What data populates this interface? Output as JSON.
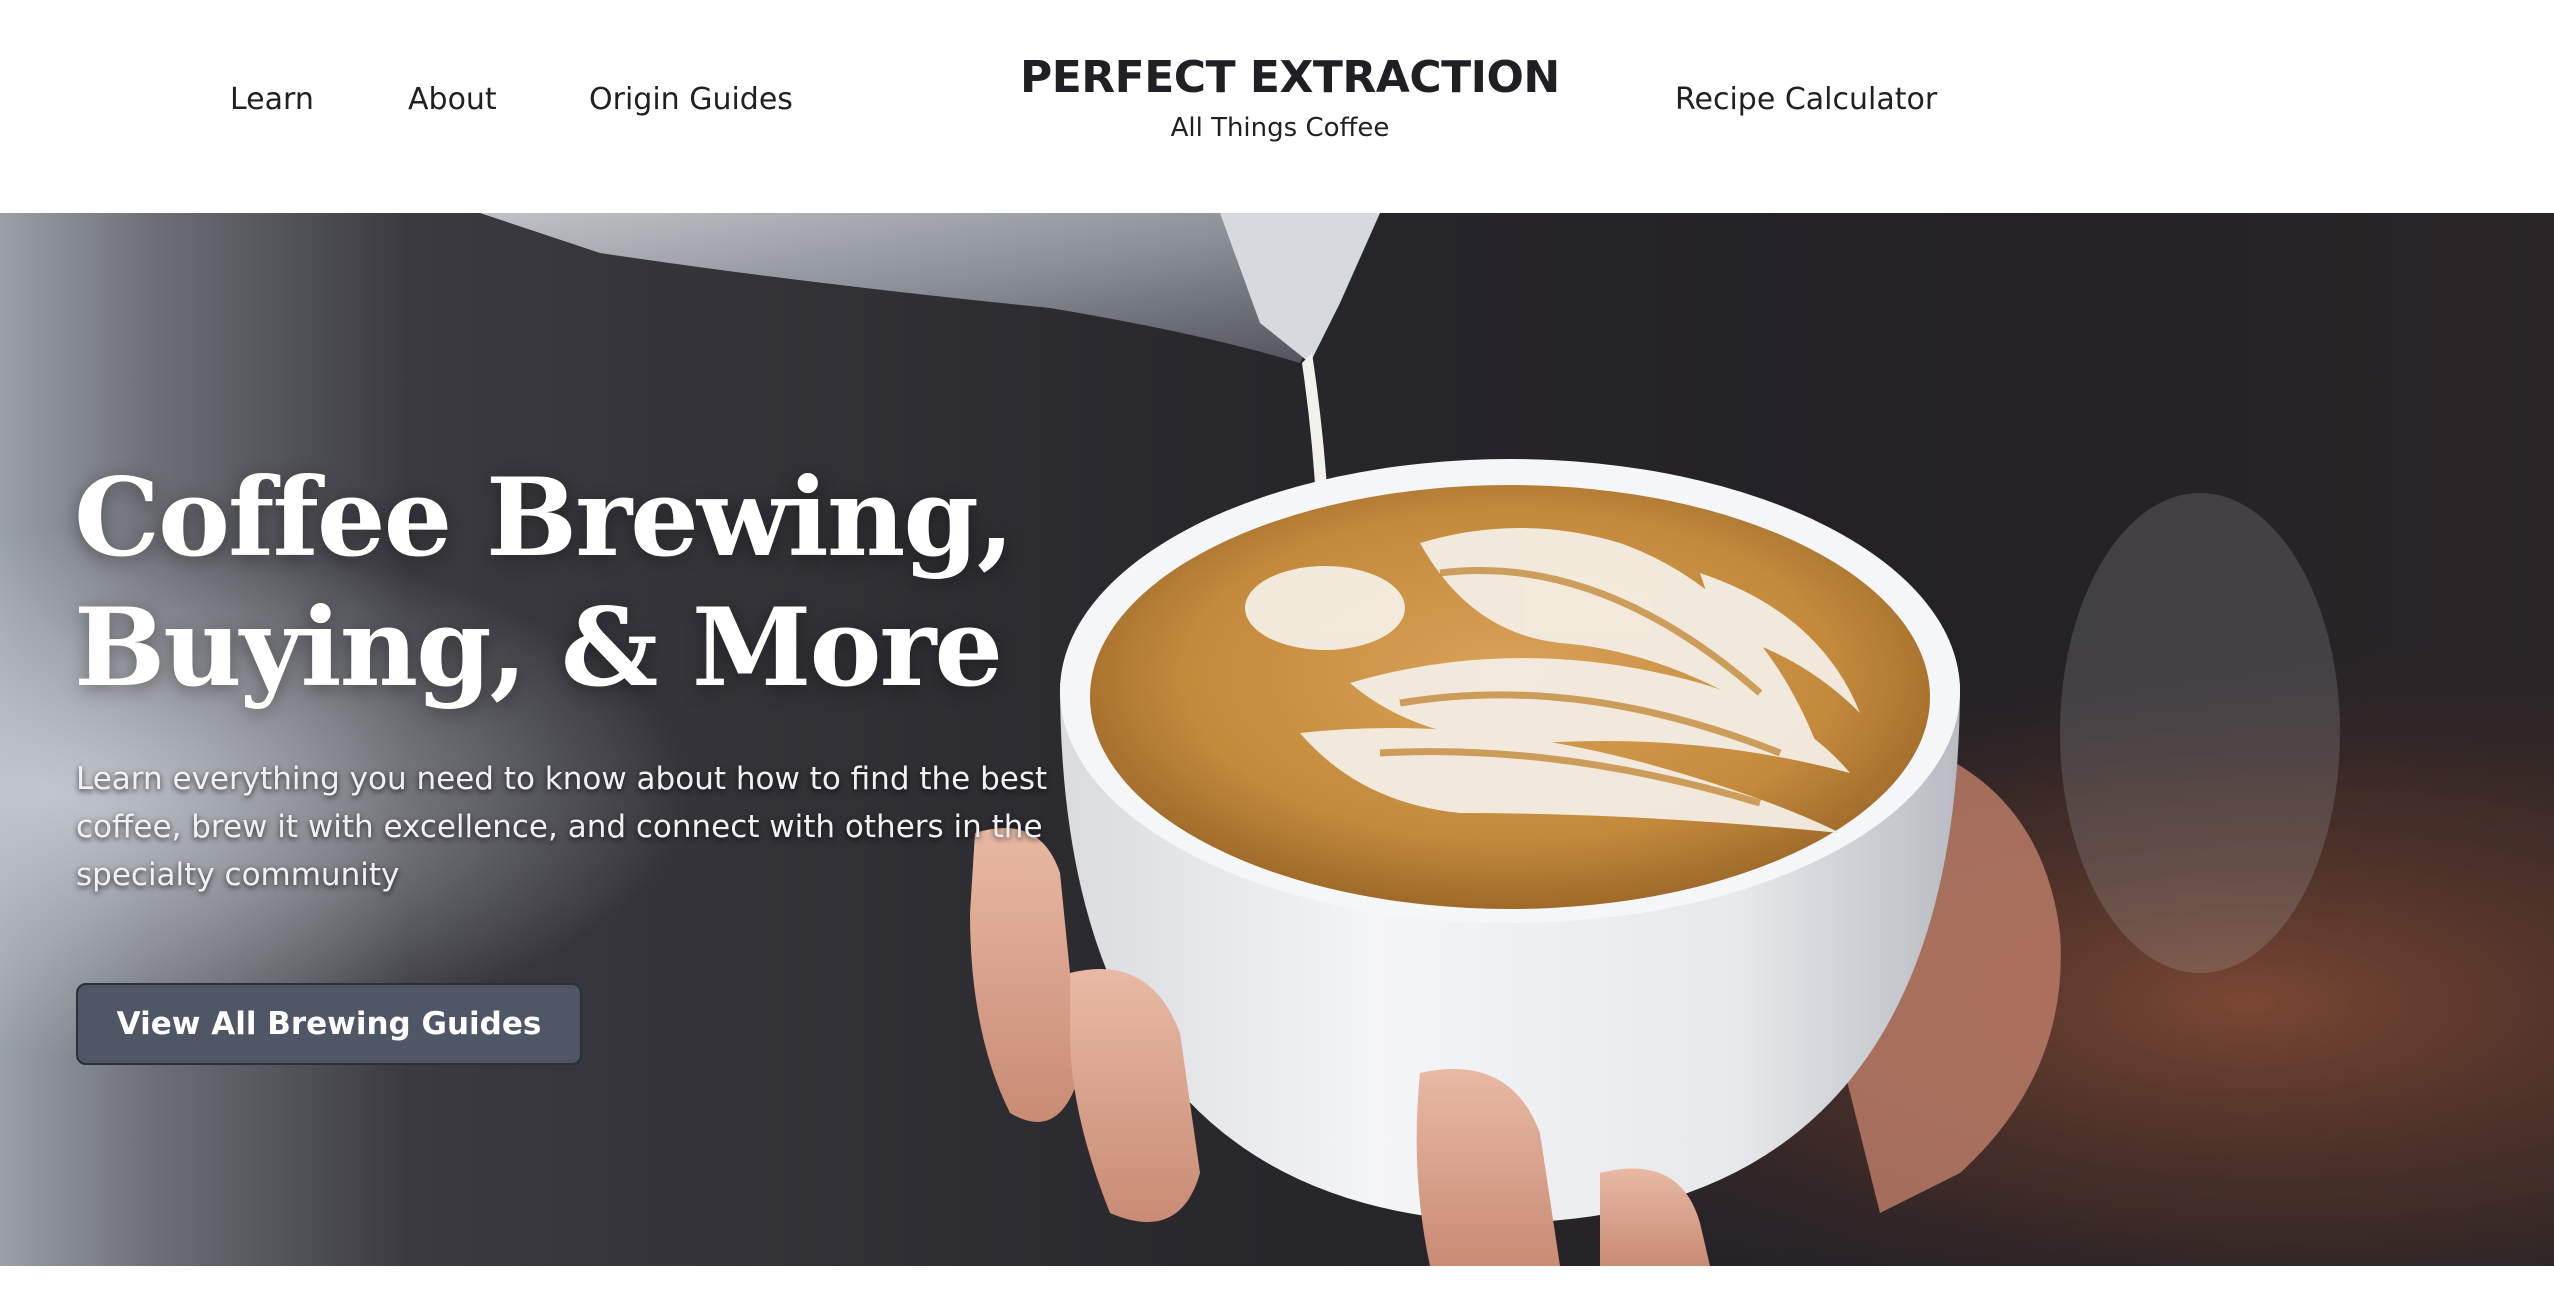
{
  "header": {
    "nav_left": [
      {
        "label": "Learn"
      },
      {
        "label": "About"
      },
      {
        "label": "Origin Guides"
      }
    ],
    "brand": {
      "title": "PERFECT EXTRACTION",
      "tagline": "All Things Coffee"
    },
    "nav_right": [
      {
        "label": "Recipe Calculator"
      }
    ]
  },
  "hero": {
    "heading_line1": "Coffee Brewing,",
    "heading_line2": "Buying, & More",
    "description": "Learn everything you need to know about how to find the best coffee, brew it with excellence, and connect with others in the specialty community",
    "cta_label": "View All Brewing Guides",
    "image": "latte-art-pour-photo"
  },
  "colors": {
    "text_dark": "#1f1f24",
    "button_bg": "#4f5666",
    "hero_bg": "#25252a",
    "crema": "#c98f3e"
  }
}
